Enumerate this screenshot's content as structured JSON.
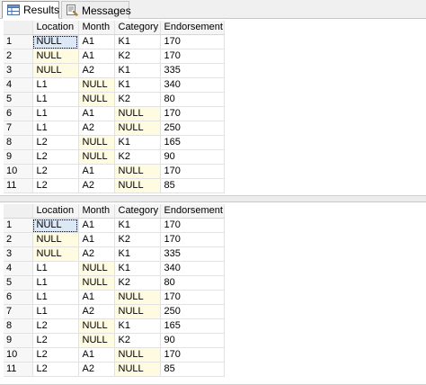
{
  "tabs": [
    {
      "label": "Results"
    },
    {
      "label": "Messages"
    }
  ],
  "columns": [
    "",
    "Location",
    "Month",
    "Category",
    "Endorsement"
  ],
  "rows": [
    {
      "num": "1",
      "cells": [
        "NULL",
        "A1",
        "K1",
        "170"
      ]
    },
    {
      "num": "2",
      "cells": [
        "NULL",
        "A1",
        "K2",
        "170"
      ]
    },
    {
      "num": "3",
      "cells": [
        "NULL",
        "A2",
        "K1",
        "335"
      ]
    },
    {
      "num": "4",
      "cells": [
        "L1",
        "NULL",
        "K1",
        "340"
      ]
    },
    {
      "num": "5",
      "cells": [
        "L1",
        "NULL",
        "K2",
        "80"
      ]
    },
    {
      "num": "6",
      "cells": [
        "L1",
        "A1",
        "NULL",
        "170"
      ]
    },
    {
      "num": "7",
      "cells": [
        "L1",
        "A2",
        "NULL",
        "250"
      ]
    },
    {
      "num": "8",
      "cells": [
        "L2",
        "NULL",
        "K1",
        "165"
      ]
    },
    {
      "num": "9",
      "cells": [
        "L2",
        "NULL",
        "K2",
        "90"
      ]
    },
    {
      "num": "10",
      "cells": [
        "L2",
        "A1",
        "NULL",
        "170"
      ]
    },
    {
      "num": "11",
      "cells": [
        "L2",
        "A2",
        "NULL",
        "85"
      ]
    }
  ],
  "colors": {
    "null_cell_bg": "#fffbe0",
    "selected_cell_bg": "#dde8f6"
  }
}
